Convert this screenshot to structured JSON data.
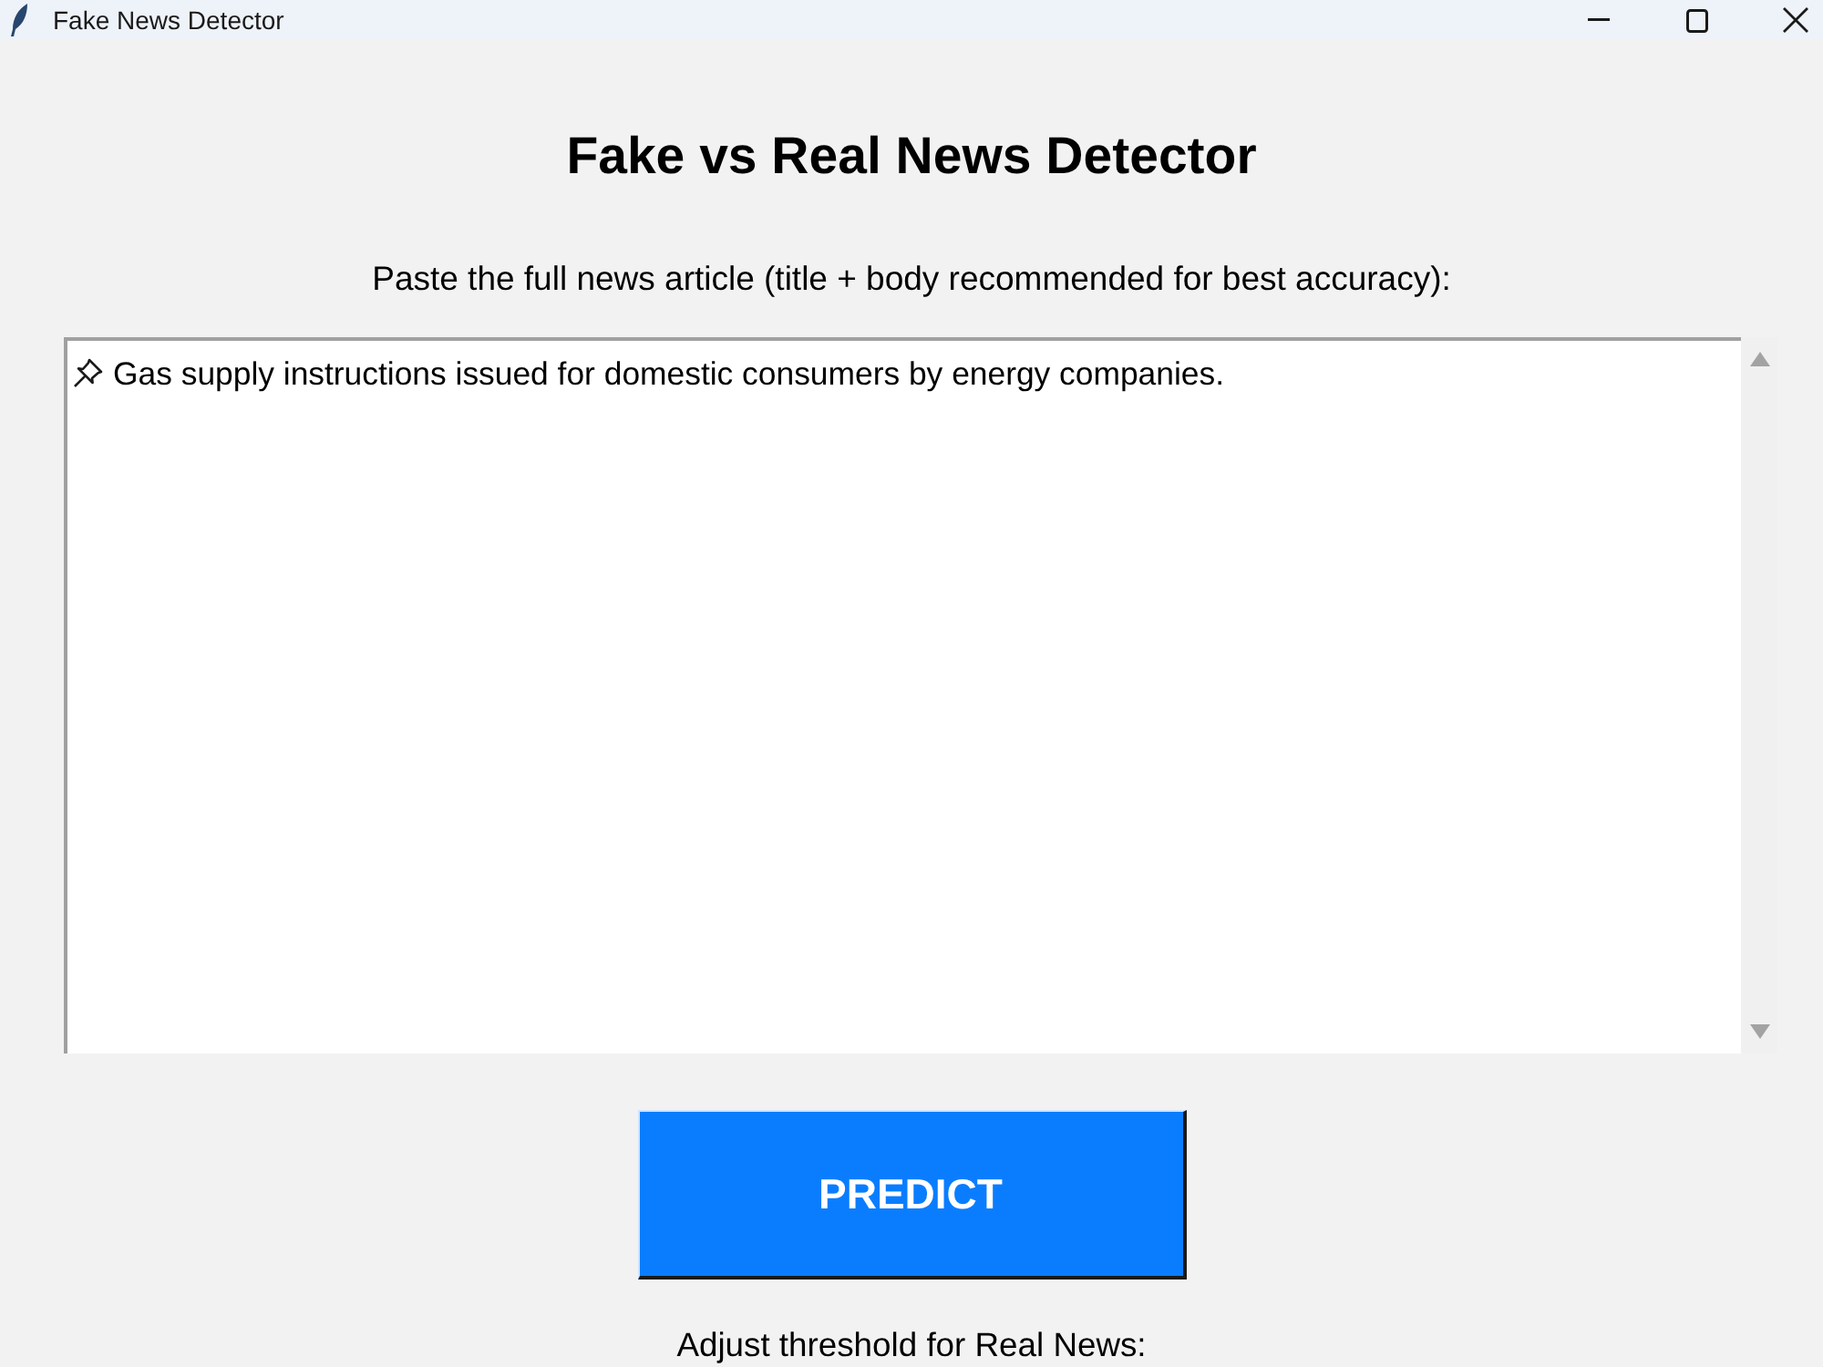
{
  "window": {
    "title": "Fake News Detector"
  },
  "heading": "Fake vs Real News Detector",
  "prompt": "Paste the full news article (title + body recommended for best accuracy):",
  "article": {
    "value": "Gas supply instructions issued for domestic consumers by energy companies."
  },
  "predict_button": {
    "label": "PREDICT"
  },
  "threshold": {
    "label": "Adjust threshold for Real News:"
  }
}
